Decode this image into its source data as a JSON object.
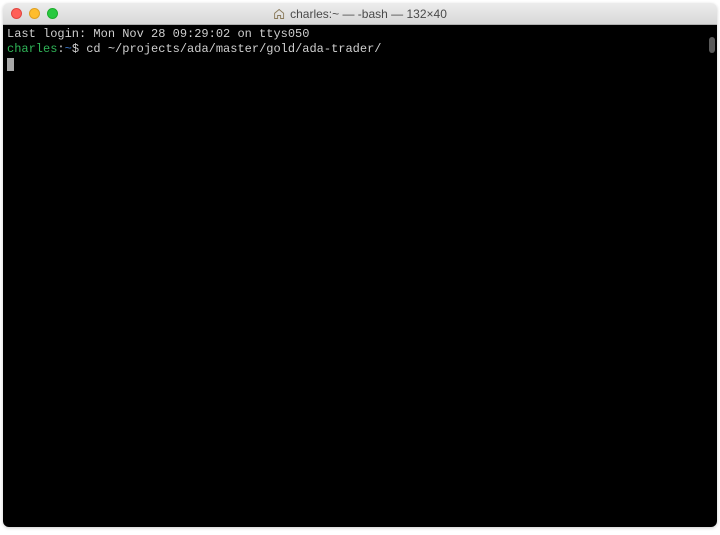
{
  "titlebar": {
    "title": "charles:~ — -bash — 132×40"
  },
  "terminal": {
    "last_login": "Last login: Mon Nov 28 09:29:02 on ttys050",
    "prompt": {
      "user_host": "charles",
      "separator": ":",
      "path": "~",
      "symbol": "$"
    },
    "command": "cd ~/projects/ada/master/gold/ada-trader/"
  }
}
